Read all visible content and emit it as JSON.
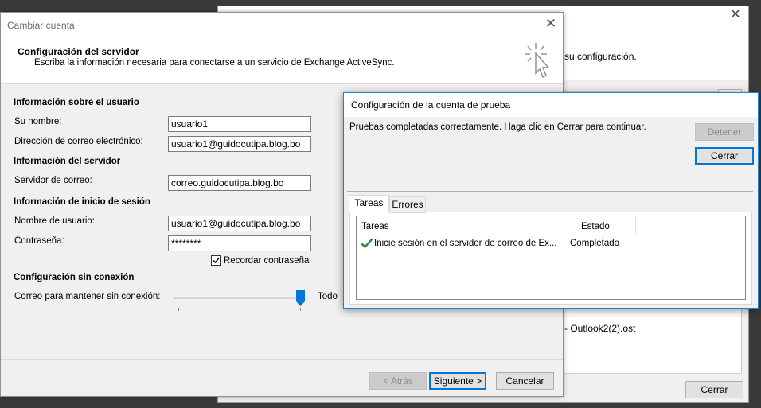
{
  "background_window": {
    "description_fragment": "su configuración.",
    "file_fragment": "- Outlook2(2).ost",
    "cerrar_label": "Cerrar"
  },
  "main_dialog": {
    "title": "Cambiar cuenta",
    "header": {
      "title": "Configuración del servidor",
      "subtitle": "Escriba la información necesaria para conectarse a un servicio de Exchange ActiveSync."
    },
    "user_section": "Información sobre el usuario",
    "name_label": "Su nombre:",
    "name_value": "usuario1",
    "email_label": "Dirección de correo electrónico:",
    "email_value": "usuario1@guidocutipa.blog.bo",
    "server_section": "Información del servidor",
    "mail_server_label": "Servidor de correo:",
    "mail_server_value": "correo.guidocutipa.blog.bo",
    "logon_section": "Información de inicio de sesión",
    "username_label": "Nombre de usuario:",
    "username_value": "usuario1@guidocutipa.blog.bo",
    "password_label": "Contraseña:",
    "password_value": "********",
    "remember_label": "Recordar contraseña",
    "remember_checked": true,
    "offline_section": "Configuración sin conexión",
    "offline_label": "Correo para mantener sin conexión:",
    "offline_value": "Todo",
    "offline_slider_fraction": 1.0,
    "buttons": {
      "back": "< Atrás",
      "next": "Siguiente >",
      "cancel": "Cancelar"
    }
  },
  "test_dialog": {
    "title": "Configuración de la cuenta de prueba",
    "message": "Pruebas completadas correctamente. Haga clic en Cerrar para continuar.",
    "stop_label": "Detener",
    "close_label": "Cerrar",
    "tabs": [
      {
        "label": "Tareas",
        "active": true
      },
      {
        "label": "Errores",
        "active": false
      }
    ],
    "columns": [
      "Tareas",
      "Estado"
    ],
    "rows": [
      {
        "task": "Inicie sesión en el servidor de correo de Ex...",
        "status": "Completado",
        "icon": "checkmark-icon"
      }
    ]
  },
  "colors": {
    "accent": "#0078d7",
    "check_green": "#1e8a32"
  }
}
